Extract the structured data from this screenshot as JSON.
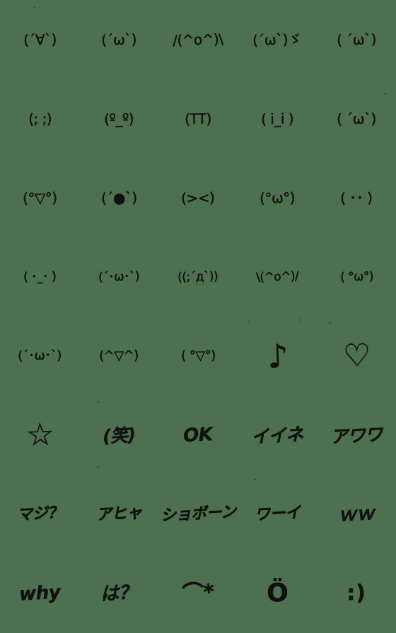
{
  "sheet": {
    "title": "kaomoji-sticker-sheet",
    "background_color": "#4c7050",
    "ink_color": "#111110",
    "columns": 5,
    "rows": 8
  },
  "items": [
    {
      "id": "r1c1",
      "name": "kaomoji-happy-closed-eyes",
      "text": "(´∀`)",
      "kind": "kaomoji"
    },
    {
      "id": "r1c2",
      "name": "kaomoji-omega-smile",
      "text": "(´ω`)",
      "kind": "kaomoji"
    },
    {
      "id": "r1c3",
      "name": "kaomoji-banzai-arms",
      "text": "/(^o^)\\",
      "kind": "kaomoji"
    },
    {
      "id": "r1c4",
      "name": "kaomoji-wink-note",
      "text": "(´ω`)ゞ",
      "kind": "kaomoji"
    },
    {
      "id": "r1c5",
      "name": "kaomoji-omega-calm",
      "text": "( ´ω`)",
      "kind": "kaomoji"
    },
    {
      "id": "r2c1",
      "name": "kaomoji-crying-tears",
      "text": "(; ;)",
      "kind": "kaomoji"
    },
    {
      "id": "r2c2",
      "name": "kaomoji-teary-eyes",
      "text": "(º_º)",
      "kind": "kaomoji"
    },
    {
      "id": "r2c3",
      "name": "kaomoji-sobbing-tt",
      "text": "(TT)",
      "kind": "kaomoji"
    },
    {
      "id": "r2c4",
      "name": "kaomoji-sad-dot-eyes",
      "text": "( i_i )",
      "kind": "kaomoji"
    },
    {
      "id": "r2c5",
      "name": "kaomoji-shy-omega",
      "text": "( ´ω`)",
      "kind": "kaomoji"
    },
    {
      "id": "r3c1",
      "name": "kaomoji-grin-v-mouth",
      "text": "(°▽°)",
      "kind": "kaomoji"
    },
    {
      "id": "r3c2",
      "name": "kaomoji-open-mouth",
      "text": "(´●`)",
      "kind": "kaomoji"
    },
    {
      "id": "r3c3",
      "name": "kaomoji-squinting-x",
      "text": "(><)",
      "kind": "kaomoji"
    },
    {
      "id": "r3c4",
      "name": "kaomoji-round-eyes-omega",
      "text": "(°ω°)",
      "kind": "kaomoji"
    },
    {
      "id": "r3c5",
      "name": "kaomoji-blank-dots",
      "text": "( ･･ )",
      "kind": "kaomoji"
    },
    {
      "id": "r4c1",
      "name": "kaomoji-neutral-face",
      "text": "( ･_･ )",
      "kind": "kaomoji"
    },
    {
      "id": "r4c2",
      "name": "kaomoji-gentle-omega",
      "text": "(´･ω･`)",
      "kind": "kaomoji"
    },
    {
      "id": "r4c3",
      "name": "kaomoji-panic-sweat",
      "text": "((;´д`))",
      "kind": "kaomoji"
    },
    {
      "id": "r4c4",
      "name": "kaomoji-cheering-banzai",
      "text": "\\(^o^)/",
      "kind": "kaomoji"
    },
    {
      "id": "r4c5",
      "name": "kaomoji-surprised-omega",
      "text": "( °ω°)",
      "kind": "kaomoji"
    },
    {
      "id": "r5c1",
      "name": "kaomoji-sparkle-omega",
      "text": "(´･ω･`)",
      "kind": "kaomoji"
    },
    {
      "id": "r5c2",
      "name": "kaomoji-delighted",
      "text": "(^▽^)",
      "kind": "kaomoji"
    },
    {
      "id": "r5c3",
      "name": "kaomoji-excited-v",
      "text": "( °▽°)",
      "kind": "kaomoji"
    },
    {
      "id": "r5c4",
      "name": "music-note-symbol",
      "text": "♪",
      "kind": "symbol"
    },
    {
      "id": "r5c5",
      "name": "heart-outline-symbol",
      "text": "♡",
      "kind": "symbol"
    },
    {
      "id": "r6c1",
      "name": "star-outline-symbol",
      "text": "☆",
      "kind": "symbol"
    },
    {
      "id": "r6c2",
      "name": "word-warai-laugh",
      "text": "(笑)",
      "kind": "text"
    },
    {
      "id": "r6c3",
      "name": "word-ok",
      "text": "OK",
      "kind": "text"
    },
    {
      "id": "r6c4",
      "name": "word-iine-nice",
      "text": "イイネ",
      "kind": "text"
    },
    {
      "id": "r6c5",
      "name": "word-awawa",
      "text": "アワワ",
      "kind": "text"
    },
    {
      "id": "r7c1",
      "name": "word-maji-really",
      "text": "マジ？",
      "kind": "text"
    },
    {
      "id": "r7c2",
      "name": "word-ahya",
      "text": "アヒャ",
      "kind": "text"
    },
    {
      "id": "r7c3",
      "name": "word-shobon",
      "text": "ショボーン",
      "kind": "text"
    },
    {
      "id": "r7c4",
      "name": "word-wai-yay",
      "text": "ワーイ",
      "kind": "text"
    },
    {
      "id": "r7c5",
      "name": "word-ww-laugh",
      "text": "ｗｗ",
      "kind": "text"
    },
    {
      "id": "r8c1",
      "name": "word-why",
      "text": "why",
      "kind": "text"
    },
    {
      "id": "r8c2",
      "name": "word-ha-what",
      "text": "は？",
      "kind": "text"
    },
    {
      "id": "r8c3",
      "name": "swoosh-star-symbol",
      "text": "⌒*",
      "kind": "symbol"
    },
    {
      "id": "r8c4",
      "name": "umlaut-o-face-symbol",
      "text": "Ö",
      "kind": "symbol"
    },
    {
      "id": "r8c5",
      "name": "smiley-colon-paren",
      "text": ":)",
      "kind": "symbol"
    }
  ]
}
